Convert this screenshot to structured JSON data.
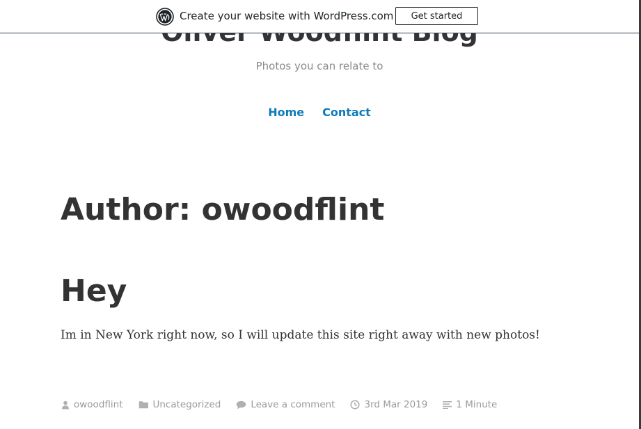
{
  "wp_banner": {
    "logo_icon": "wordpress-logo-icon",
    "text": "Create your website with WordPress.com",
    "cta_label": "Get started"
  },
  "site": {
    "title": "Oliver Woodflint Blog",
    "tagline": "Photos you can relate to"
  },
  "nav": {
    "items": [
      {
        "label": "Home"
      },
      {
        "label": "Contact"
      }
    ]
  },
  "archive": {
    "title": "Author: owoodflint"
  },
  "post": {
    "title": "Hey",
    "content": "Im in New York right now, so I will update this site right away with new photos!",
    "meta": {
      "author": "owoodflint",
      "category": "Uncategorized",
      "comments": "Leave a comment",
      "date": "3rd Mar 2019",
      "reading_time": "1 Minute"
    }
  },
  "colors": {
    "accent": "#0e7ab8",
    "text": "#333333",
    "meta": "#9a9a9a",
    "banner_border": "#2c3e50"
  }
}
